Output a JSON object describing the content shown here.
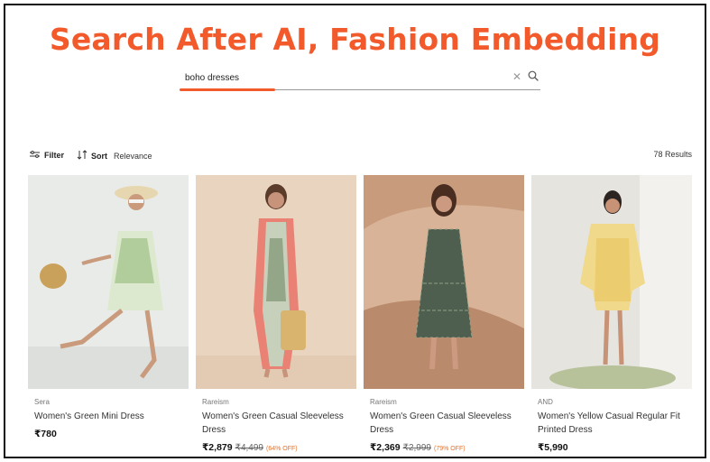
{
  "headline": "Search After AI, Fashion Embedding",
  "colors": {
    "accent": "#f25a2c",
    "discount": "#e4702a",
    "text": "#222222",
    "border": "#111111"
  },
  "search": {
    "value": "boho dresses",
    "clear_icon": "close-icon",
    "search_icon": "search-icon"
  },
  "toolbar": {
    "filter_label": "Filter",
    "filter_icon": "sliders-icon",
    "sort_label": "Sort",
    "sort_icon": "sort-arrows-icon",
    "sort_value": "Relevance",
    "results": "78 Results"
  },
  "products": [
    {
      "brand": "Sera",
      "title": "Women's Green Mini Dress",
      "price": "₹780",
      "mrp": "",
      "discount": ""
    },
    {
      "brand": "Rareism",
      "title": "Women's Green Casual Sleeveless Dress",
      "price": "₹2,879",
      "mrp": "₹4,499",
      "discount": "(64% OFF)"
    },
    {
      "brand": "Rareism",
      "title": "Women's Green Casual Sleeveless Dress",
      "price": "₹2,369",
      "mrp": "₹2,999",
      "discount": "(79% OFF)"
    },
    {
      "brand": "AND",
      "title": "Women's Yellow Casual Regular Fit Printed Dress",
      "price": "₹5,990",
      "mrp": "",
      "discount": ""
    }
  ]
}
